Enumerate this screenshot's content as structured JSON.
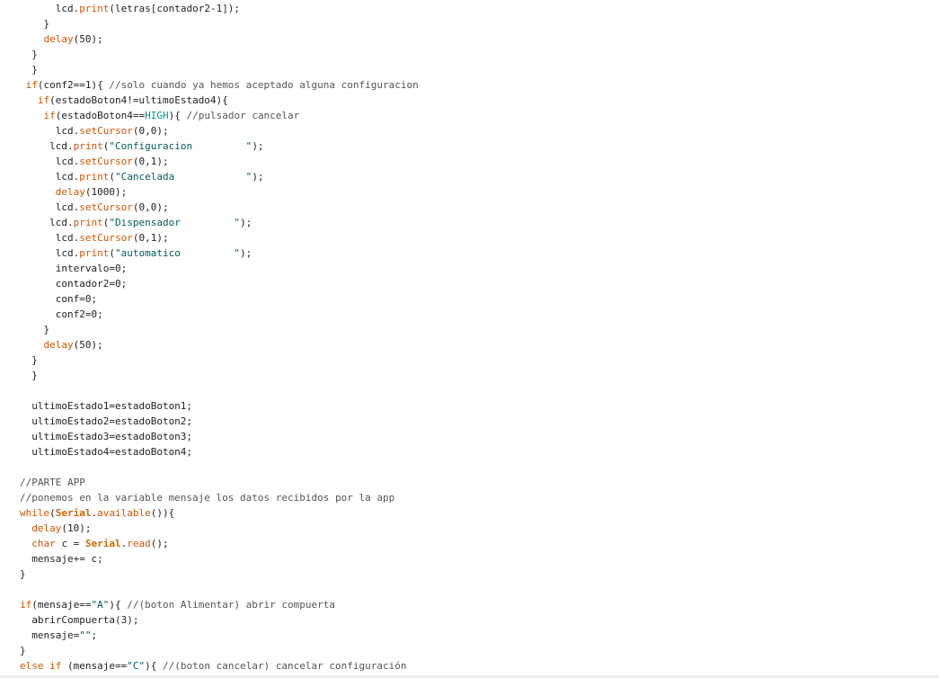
{
  "editor": {
    "lines": [
      [
        [
          "t",
          "      lcd."
        ],
        [
          "k",
          "print"
        ],
        [
          "t",
          "(letras[contador2-1]);"
        ]
      ],
      [
        [
          "t",
          "    }"
        ]
      ],
      [
        [
          "t",
          "    "
        ],
        [
          "k",
          "delay"
        ],
        [
          "t",
          "(50);"
        ]
      ],
      [
        [
          "t",
          "  }"
        ]
      ],
      [
        [
          "t",
          "  }"
        ]
      ],
      [
        [
          "t",
          " "
        ],
        [
          "k",
          "if"
        ],
        [
          "t",
          "(conf2==1){ "
        ],
        [
          "c",
          "//solo cuando ya hemos aceptado alguna configuracion"
        ]
      ],
      [
        [
          "t",
          "   "
        ],
        [
          "k",
          "if"
        ],
        [
          "t",
          "(estadoBoton4!=ultimoEstado4){"
        ]
      ],
      [
        [
          "t",
          "    "
        ],
        [
          "k",
          "if"
        ],
        [
          "t",
          "(estadoBoton4=="
        ],
        [
          "n",
          "HIGH"
        ],
        [
          "t",
          "){ "
        ],
        [
          "c",
          "//pulsador cancelar"
        ]
      ],
      [
        [
          "t",
          "      lcd."
        ],
        [
          "k",
          "setCursor"
        ],
        [
          "t",
          "(0,0);"
        ]
      ],
      [
        [
          "t",
          "     lcd."
        ],
        [
          "k",
          "print"
        ],
        [
          "t",
          "("
        ],
        [
          "s",
          "\"Configuracion         \""
        ],
        [
          "t",
          ");"
        ]
      ],
      [
        [
          "t",
          "      lcd."
        ],
        [
          "k",
          "setCursor"
        ],
        [
          "t",
          "(0,1);"
        ]
      ],
      [
        [
          "t",
          "      lcd."
        ],
        [
          "k",
          "print"
        ],
        [
          "t",
          "("
        ],
        [
          "s",
          "\"Cancelada            \""
        ],
        [
          "t",
          ");"
        ]
      ],
      [
        [
          "t",
          "      "
        ],
        [
          "k",
          "delay"
        ],
        [
          "t",
          "(1000);"
        ]
      ],
      [
        [
          "t",
          "      lcd."
        ],
        [
          "k",
          "setCursor"
        ],
        [
          "t",
          "(0,0);"
        ]
      ],
      [
        [
          "t",
          "     lcd."
        ],
        [
          "k",
          "print"
        ],
        [
          "t",
          "("
        ],
        [
          "s",
          "\"Dispensador         \""
        ],
        [
          "t",
          ");"
        ]
      ],
      [
        [
          "t",
          "      lcd."
        ],
        [
          "k",
          "setCursor"
        ],
        [
          "t",
          "(0,1);"
        ]
      ],
      [
        [
          "t",
          "      lcd."
        ],
        [
          "k",
          "print"
        ],
        [
          "t",
          "("
        ],
        [
          "s",
          "\"automatico         \""
        ],
        [
          "t",
          ");"
        ]
      ],
      [
        [
          "t",
          "      intervalo=0;"
        ]
      ],
      [
        [
          "t",
          "      contador2=0;"
        ]
      ],
      [
        [
          "t",
          "      conf=0;"
        ]
      ],
      [
        [
          "t",
          "      conf2=0;"
        ]
      ],
      [
        [
          "t",
          "    }"
        ]
      ],
      [
        [
          "t",
          "    "
        ],
        [
          "k",
          "delay"
        ],
        [
          "t",
          "(50);"
        ]
      ],
      [
        [
          "t",
          "  }"
        ]
      ],
      [
        [
          "t",
          "  }"
        ]
      ],
      [
        [
          "t",
          ""
        ]
      ],
      [
        [
          "t",
          "  ultimoEstado1=estadoBoton1;"
        ]
      ],
      [
        [
          "t",
          "  ultimoEstado2=estadoBoton2;"
        ]
      ],
      [
        [
          "t",
          "  ultimoEstado3=estadoBoton3;"
        ]
      ],
      [
        [
          "t",
          "  ultimoEstado4=estadoBoton4;"
        ]
      ],
      [
        [
          "t",
          ""
        ]
      ],
      [
        [
          "c",
          "//PARTE APP"
        ]
      ],
      [
        [
          "c",
          "//ponemos en la variable mensaje los datos recibidos por la app"
        ]
      ],
      [
        [
          "k",
          "while"
        ],
        [
          "t",
          "("
        ],
        [
          "b",
          "Serial"
        ],
        [
          "t",
          "."
        ],
        [
          "k",
          "available"
        ],
        [
          "t",
          "()){"
        ]
      ],
      [
        [
          "t",
          "  "
        ],
        [
          "k",
          "delay"
        ],
        [
          "t",
          "(10);"
        ]
      ],
      [
        [
          "t",
          "  "
        ],
        [
          "k",
          "char"
        ],
        [
          "t",
          " c = "
        ],
        [
          "b",
          "Serial"
        ],
        [
          "t",
          "."
        ],
        [
          "k",
          "read"
        ],
        [
          "t",
          "();"
        ]
      ],
      [
        [
          "t",
          "  mensaje+= c;"
        ]
      ],
      [
        [
          "t",
          "}"
        ]
      ],
      [
        [
          "t",
          ""
        ]
      ],
      [
        [
          "k",
          "if"
        ],
        [
          "t",
          "(mensaje=="
        ],
        [
          "s",
          "\"A\""
        ],
        [
          "t",
          "){ "
        ],
        [
          "c",
          "//(boton Alimentar) abrir compuerta"
        ]
      ],
      [
        [
          "t",
          "  abrirCompuerta(3);"
        ]
      ],
      [
        [
          "t",
          "  mensaje="
        ],
        [
          "s",
          "\"\""
        ],
        [
          "t",
          ";"
        ]
      ],
      [
        [
          "t",
          "}"
        ]
      ],
      [
        [
          "k",
          "else"
        ],
        [
          "t",
          " "
        ],
        [
          "k",
          "if"
        ],
        [
          "t",
          " (mensaje=="
        ],
        [
          "s",
          "\"C\""
        ],
        [
          "t",
          "){ "
        ],
        [
          "c",
          "//(boton cancelar) cancelar configuración"
        ]
      ]
    ]
  },
  "colors": {
    "background": "#ffffff",
    "text": "#222222",
    "keyword": "#d35400",
    "class": "#cc6600",
    "constant": "#00979c",
    "string": "#005c5f",
    "comment": "#555555"
  }
}
